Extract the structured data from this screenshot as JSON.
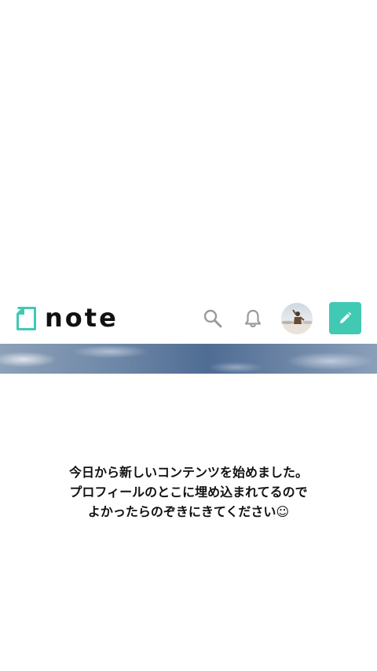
{
  "header": {
    "logo_text": "note",
    "brand_color": "#41c9b4",
    "icons": [
      "search-icon",
      "bell-icon",
      "avatar",
      "pencil-icon"
    ]
  },
  "message": {
    "lines": [
      "今日から新しいコンテンツを始めました。",
      "プロフィールのとこに埋め込まれてるので",
      "よかったらのぞきにきてください☺"
    ]
  }
}
